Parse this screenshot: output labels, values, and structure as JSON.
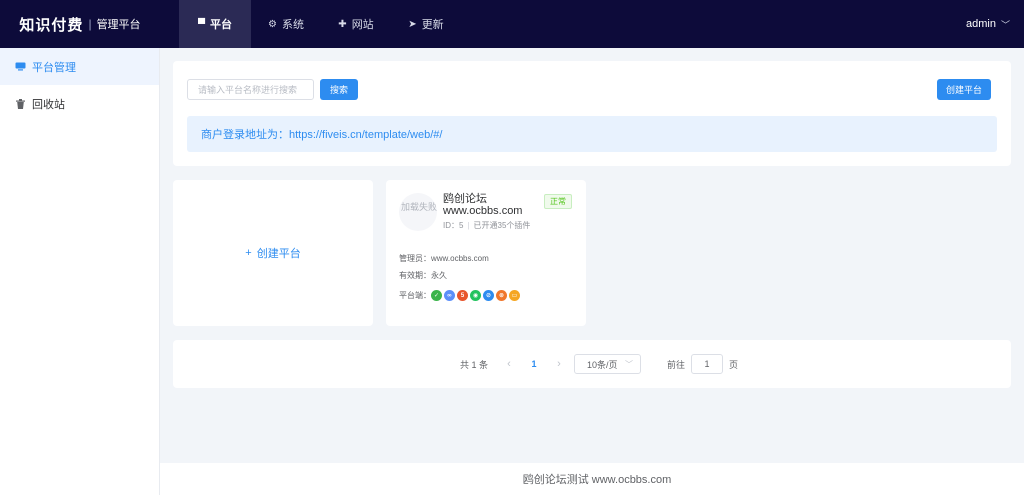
{
  "header": {
    "brand_main": "知识付费",
    "brand_sep": "|",
    "brand_sub": "管理平台",
    "nav": [
      {
        "label": "平台",
        "icon": "monitor-icon",
        "glyph": "▀",
        "active": true
      },
      {
        "label": "系统",
        "icon": "gear-icon",
        "glyph": "⚙",
        "active": false
      },
      {
        "label": "网站",
        "icon": "globe-icon",
        "glyph": "✚",
        "active": false
      },
      {
        "label": "更新",
        "icon": "send-icon",
        "glyph": "➤",
        "active": false
      }
    ],
    "user": "admin"
  },
  "sidebar": {
    "items": [
      {
        "label": "平台管理",
        "icon": "platform-icon",
        "active": true
      },
      {
        "label": "回收站",
        "icon": "trash-icon",
        "active": false
      }
    ]
  },
  "search": {
    "placeholder": "请输入平台名称进行搜索",
    "search_label": "搜索",
    "create_label": "创建平台",
    "notice": "商户登录地址为：https://fiveis.cn/template/web/#/"
  },
  "create_card": {
    "plus": "+",
    "label": "创建平台"
  },
  "platform": {
    "logo_text": "加载失败",
    "name": "鸥创论坛 www.ocbbs.com",
    "id_text": "ID：5",
    "bar": "|",
    "plugins_text": "已开通35个插件",
    "status": "正常",
    "admin_label": "管理员：",
    "admin_value": "www.ocbbs.com",
    "expiry_label": "有效期：",
    "expiry_value": "永久",
    "channels_label": "平台端：",
    "channels": [
      {
        "icon": "wechat-icon",
        "color": "#3bb44a",
        "glyph": "✓"
      },
      {
        "icon": "link-icon",
        "color": "#5b8ff9",
        "glyph": "∞"
      },
      {
        "icon": "h5-icon",
        "color": "#e8552d",
        "glyph": "5"
      },
      {
        "icon": "whatsapp-icon",
        "color": "#22c35e",
        "glyph": "◉"
      },
      {
        "icon": "safari-icon",
        "color": "#2d8cf0",
        "glyph": "⊘"
      },
      {
        "icon": "weibo-icon",
        "color": "#f0772d",
        "glyph": "⊛"
      },
      {
        "icon": "pc-icon",
        "color": "#f5a623",
        "glyph": "▭"
      }
    ]
  },
  "pager": {
    "total": "共 1 条",
    "prev": "‹",
    "page": "1",
    "next": "›",
    "size": "10条/页",
    "goto_label": "前往",
    "goto_value": "1",
    "goto_suffix": "页"
  },
  "footer": {
    "text": "鸥创论坛测试 www.ocbbs.com"
  }
}
